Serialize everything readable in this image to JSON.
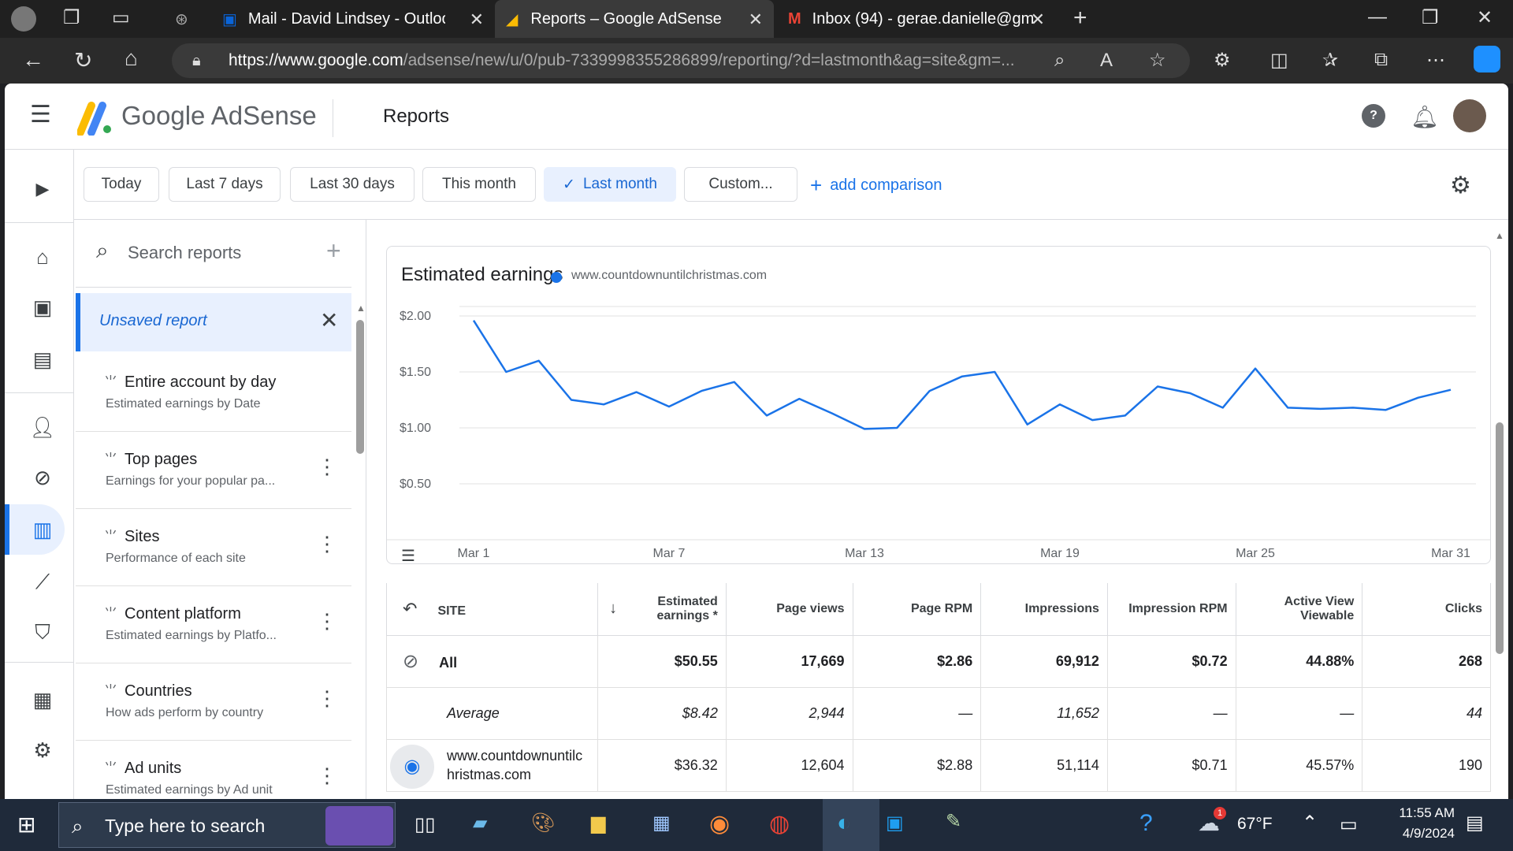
{
  "browser": {
    "tabs": [
      {
        "label": "Mail - David Lindsey - Outlook"
      },
      {
        "label": "Reports – Google AdSense"
      },
      {
        "label": "Inbox (94) - gerae.danielle@gma"
      }
    ],
    "url_domain": "https://www.google.com",
    "url_path": "/adsense/new/u/0/pub-7339998355286899/reporting/?d=lastmonth&ag=site&gm=..."
  },
  "header": {
    "product_name": "Google AdSense",
    "page_title": "Reports"
  },
  "filters": {
    "chips": [
      "Today",
      "Last 7 days",
      "Last 30 days",
      "This month",
      "Last month",
      "Custom..."
    ],
    "selected": "Last month",
    "add_comparison": "add comparison"
  },
  "sidebar": {
    "search_placeholder": "Search reports",
    "unsaved": "Unsaved report",
    "reports": [
      {
        "title": "Entire account by day",
        "subtitle": "Estimated earnings by Date"
      },
      {
        "title": "Top pages",
        "subtitle": "Earnings for your popular pa..."
      },
      {
        "title": "Sites",
        "subtitle": "Performance of each site"
      },
      {
        "title": "Content platform",
        "subtitle": "Estimated earnings by Platfo..."
      },
      {
        "title": "Countries",
        "subtitle": "How ads perform by country"
      },
      {
        "title": "Ad units",
        "subtitle": "Estimated earnings by Ad unit"
      }
    ]
  },
  "chart_data": {
    "type": "line",
    "title": "Estimated earnings",
    "series": [
      {
        "name": "www.countdownuntilchristmas.com",
        "color": "#1a73e8",
        "values": [
          1.96,
          1.5,
          1.6,
          1.25,
          1.21,
          1.32,
          1.19,
          1.33,
          1.41,
          1.11,
          1.26,
          1.13,
          0.99,
          1.0,
          1.33,
          1.46,
          1.5,
          1.03,
          1.21,
          1.07,
          1.11,
          1.37,
          1.31,
          1.18,
          1.53,
          1.18,
          1.17,
          1.18,
          1.16,
          1.27,
          1.34
        ]
      }
    ],
    "x": [
      "Mar 1",
      "Mar 2",
      "Mar 3",
      "Mar 4",
      "Mar 5",
      "Mar 6",
      "Mar 7",
      "Mar 8",
      "Mar 9",
      "Mar 10",
      "Mar 11",
      "Mar 12",
      "Mar 13",
      "Mar 14",
      "Mar 15",
      "Mar 16",
      "Mar 17",
      "Mar 18",
      "Mar 19",
      "Mar 20",
      "Mar 21",
      "Mar 22",
      "Mar 23",
      "Mar 24",
      "Mar 25",
      "Mar 26",
      "Mar 27",
      "Mar 28",
      "Mar 29",
      "Mar 30",
      "Mar 31"
    ],
    "xticks": [
      "Mar 1",
      "Mar 7",
      "Mar 13",
      "Mar 19",
      "Mar 25",
      "Mar 31"
    ],
    "yticks": [
      "$2.00",
      "$1.50",
      "$1.00",
      "$0.50"
    ],
    "ylim": [
      0.5,
      2.0
    ],
    "grid": true,
    "legend": "top-left"
  },
  "table": {
    "headers": [
      "SITE",
      "Estimated earnings *",
      "Page views",
      "Page RPM",
      "Impressions",
      "Impression RPM",
      "Active View Viewable",
      "Clicks"
    ],
    "rows": [
      {
        "site": "All",
        "vals": [
          "$50.55",
          "17,669",
          "$2.86",
          "69,912",
          "$0.72",
          "44.88%",
          "268"
        ]
      },
      {
        "site": "Average",
        "vals": [
          "$8.42",
          "2,944",
          "—",
          "11,652",
          "—",
          "—",
          "44"
        ]
      },
      {
        "site": "www.countdownuntilchristmas.com",
        "vals": [
          "$36.32",
          "12,604",
          "$2.88",
          "51,114",
          "$0.71",
          "45.57%",
          "190"
        ]
      }
    ]
  },
  "taskbar": {
    "search_placeholder": "Type here to search",
    "weather": "67°F",
    "time": "11:55 AM",
    "date": "4/9/2024",
    "weather_badge": "1"
  }
}
